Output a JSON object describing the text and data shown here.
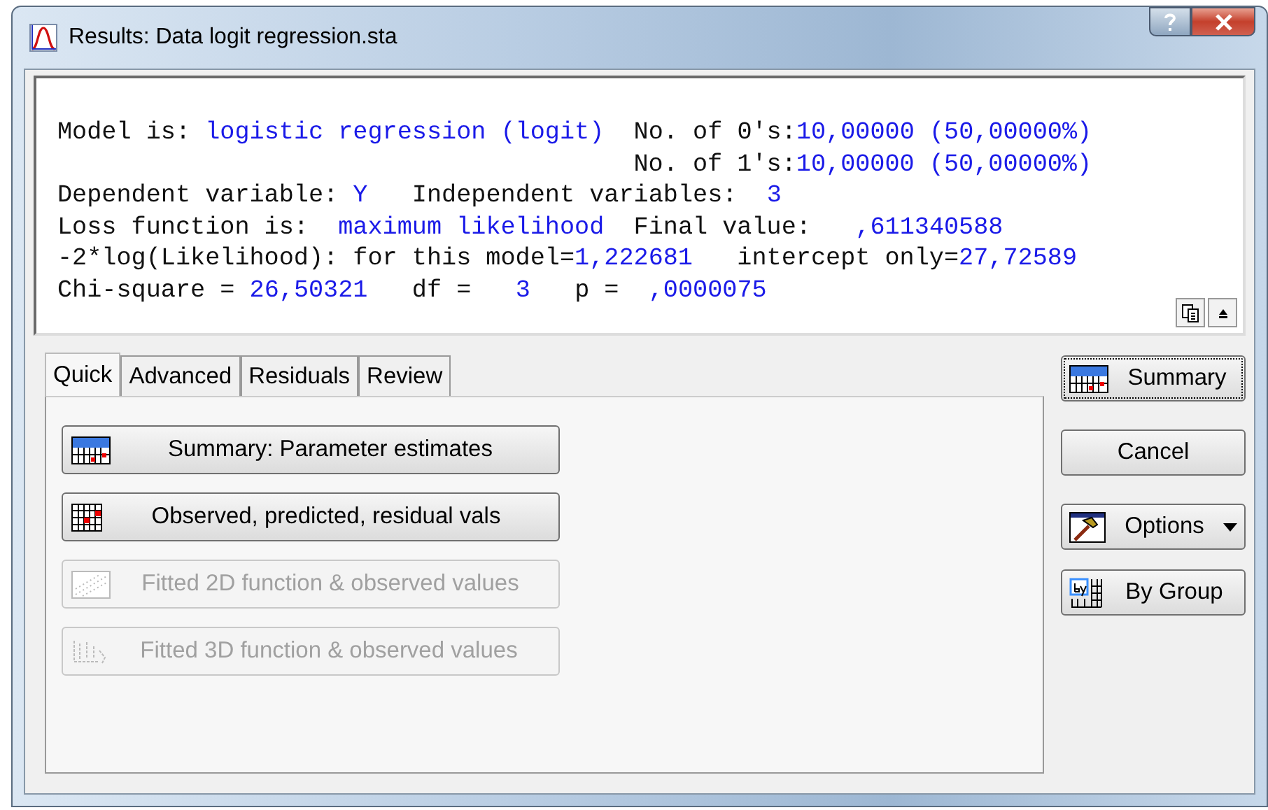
{
  "window": {
    "title": "Results: Data logit regression.sta"
  },
  "output": {
    "lines": [
      {
        "indent": false,
        "segments": [
          {
            "kind": "label",
            "text": "Model is: "
          },
          {
            "kind": "value",
            "text": "logistic regression (logit)"
          },
          {
            "kind": "label",
            "text": "  No. of 0's:"
          },
          {
            "kind": "value",
            "text": "10,00000 (50,00000%)"
          }
        ]
      },
      {
        "indent": true,
        "segments": [
          {
            "kind": "label",
            "text": "No. of 1's:"
          },
          {
            "kind": "value",
            "text": "10,00000 (50,00000%)"
          }
        ]
      },
      {
        "indent": false,
        "segments": [
          {
            "kind": "label",
            "text": "Dependent variable: "
          },
          {
            "kind": "value",
            "text": "Y"
          },
          {
            "kind": "label",
            "text": "   Independent variables:  "
          },
          {
            "kind": "value",
            "text": "3"
          }
        ]
      },
      {
        "indent": false,
        "segments": [
          {
            "kind": "label",
            "text": "Loss function is:  "
          },
          {
            "kind": "value",
            "text": "maximum likelihood"
          },
          {
            "kind": "label",
            "text": "  Final value:   "
          },
          {
            "kind": "value",
            "text": ",611340588"
          }
        ]
      },
      {
        "indent": false,
        "segments": [
          {
            "kind": "label",
            "text": "-2*log(Likelihood): for this model="
          },
          {
            "kind": "value",
            "text": "1,222681"
          },
          {
            "kind": "label",
            "text": "   intercept only="
          },
          {
            "kind": "value",
            "text": "27,72589"
          }
        ]
      },
      {
        "indent": false,
        "segments": [
          {
            "kind": "label",
            "text": "Chi-square = "
          },
          {
            "kind": "value",
            "text": "26,50321"
          },
          {
            "kind": "label",
            "text": "   df =   "
          },
          {
            "kind": "value",
            "text": "3"
          },
          {
            "kind": "label",
            "text": "   p =  "
          },
          {
            "kind": "value",
            "text": ",0000075"
          }
        ]
      }
    ]
  },
  "tabs": [
    {
      "label": "Quick",
      "selected": true
    },
    {
      "label": "Advanced",
      "selected": false
    },
    {
      "label": "Residuals",
      "selected": false
    },
    {
      "label": "Review",
      "selected": false
    }
  ],
  "actions": [
    {
      "label": "Summary: Parameter estimates",
      "disabled": false
    },
    {
      "label": "Observed, predicted, residual vals",
      "disabled": false
    },
    {
      "label": "Fitted 2D function & observed values",
      "disabled": true
    },
    {
      "label": "Fitted 3D function & observed values",
      "disabled": true
    }
  ],
  "side_buttons": [
    {
      "label": "Summary",
      "focused": true,
      "dropdown": false
    },
    {
      "label": "Cancel",
      "focused": false,
      "dropdown": false
    },
    {
      "label": "Options",
      "focused": false,
      "dropdown": true
    },
    {
      "label": "By Group",
      "focused": false,
      "dropdown": false
    }
  ]
}
